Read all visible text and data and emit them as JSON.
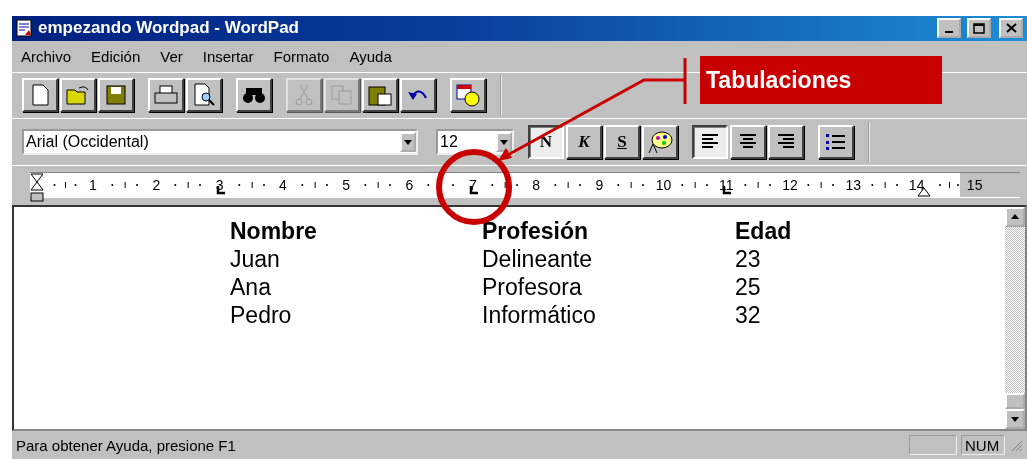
{
  "window": {
    "title": "empezando Wordpad - WordPad"
  },
  "menu": [
    {
      "label": "Archivo"
    },
    {
      "label": "Edición"
    },
    {
      "label": "Ver"
    },
    {
      "label": "Insertar"
    },
    {
      "label": "Formato"
    },
    {
      "label": "Ayuda"
    }
  ],
  "toolbar": [
    [
      {
        "kind": "new",
        "disabled": false
      },
      {
        "kind": "open",
        "disabled": false
      },
      {
        "kind": "save",
        "disabled": false
      }
    ],
    [
      {
        "kind": "print",
        "disabled": false
      },
      {
        "kind": "preview",
        "disabled": false
      }
    ],
    [
      {
        "kind": "find",
        "disabled": false
      }
    ],
    [
      {
        "kind": "cut",
        "disabled": true
      },
      {
        "kind": "copy",
        "disabled": true
      },
      {
        "kind": "paste",
        "disabled": false
      },
      {
        "kind": "undo",
        "disabled": false
      }
    ],
    [
      {
        "kind": "date",
        "disabled": false
      }
    ]
  ],
  "format_bar": {
    "font": "Arial (Occidental)",
    "size": "12",
    "styles": [
      {
        "label": "N",
        "kind": "bold",
        "selected": true
      },
      {
        "label": "K",
        "kind": "italic",
        "selected": false
      },
      {
        "label": "S",
        "kind": "underline",
        "selected": false
      },
      {
        "kind": "color",
        "selected": false
      }
    ],
    "alignment": [
      {
        "kind": "left",
        "selected": true
      },
      {
        "kind": "center",
        "selected": false
      },
      {
        "kind": "right",
        "selected": false
      }
    ],
    "bullets": {
      "selected": false
    }
  },
  "ruler": {
    "marks": [
      {
        "label": "1",
        "tab_stop": false
      },
      {
        "label": "2",
        "tab_stop": false
      },
      {
        "label": "3",
        "tab_stop": true
      },
      {
        "label": "4",
        "tab_stop": false
      },
      {
        "label": "5",
        "tab_stop": false
      },
      {
        "label": "6",
        "tab_stop": false
      },
      {
        "label": "7",
        "tab_stop": true
      },
      {
        "label": "8",
        "tab_stop": false
      },
      {
        "label": "9",
        "tab_stop": false
      },
      {
        "label": "10",
        "tab_stop": false
      },
      {
        "label": "11",
        "tab_stop": true
      },
      {
        "label": "12",
        "tab_stop": false
      },
      {
        "label": "13",
        "tab_stop": false
      },
      {
        "label": "14",
        "tab_stop": false
      },
      {
        "label": "15",
        "tab_stop": false
      }
    ]
  },
  "document": {
    "rows": [
      {
        "kind": "header",
        "cells": [
          "Nombre",
          "Profesión",
          "Edad"
        ]
      },
      {
        "kind": "data",
        "cells": [
          "Juan",
          "Delineante",
          "23"
        ]
      },
      {
        "kind": "data",
        "cells": [
          "Ana",
          "Profesora",
          "25"
        ]
      },
      {
        "kind": "data",
        "cells": [
          "Pedro",
          "Informático",
          "32"
        ]
      }
    ]
  },
  "status_bar": {
    "message": "Para obtener Ayuda, presione F1",
    "indicator": "NUM"
  },
  "callout": {
    "label": "Tabulaciones"
  }
}
